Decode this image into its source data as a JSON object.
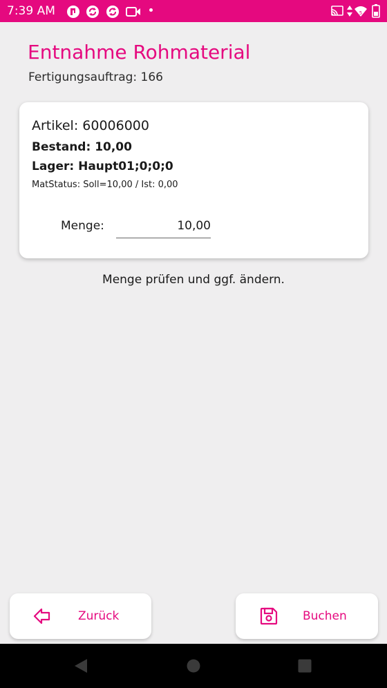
{
  "status_bar": {
    "time": "7:39 AM",
    "left_icons": [
      "notification-app-icon",
      "sync-icon",
      "sync-icon",
      "video-icon",
      "dot"
    ],
    "right_icons": [
      "cast-icon",
      "data-arrows-icon",
      "wifi-icon",
      "battery-icon"
    ]
  },
  "header": {
    "title": "Entnahme Rohmaterial",
    "subtitle": "Fertigungsauftrag: 166"
  },
  "card": {
    "artikel": "Artikel: 60006000",
    "bestand": "Bestand: 10,00",
    "lager": "Lager: Haupt01;0;0;0",
    "matstatus": "MatStatus: Soll=10,00 / Ist: 0,00",
    "menge_label": "Menge:",
    "menge_value": "10,00"
  },
  "hint": "Menge prüfen und ggf. ändern.",
  "buttons": {
    "back_label": "Zurück",
    "back_icon": "arrow-left-icon",
    "book_label": "Buchen",
    "book_icon": "save-icon"
  },
  "nav_bar": {
    "icons": [
      "back-triangle-icon",
      "home-circle-icon",
      "recents-square-icon"
    ]
  },
  "colors": {
    "accent": "#e5097f",
    "background": "#efeeef",
    "card": "#ffffff",
    "nav_bar": "#000000"
  }
}
